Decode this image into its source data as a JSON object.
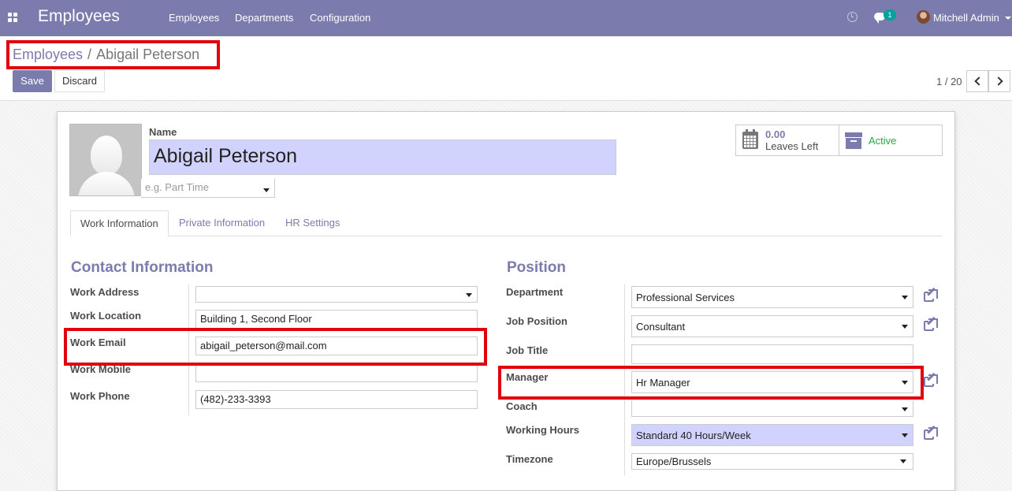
{
  "navbar": {
    "app_title": "Employees",
    "menu": [
      "Employees",
      "Departments",
      "Configuration"
    ],
    "notification_count": "1",
    "user_name": "Mitchell Admin",
    "bg_color": "#7c7bad"
  },
  "breadcrumb": {
    "parent": "Employees",
    "separator": "/",
    "current": "Abigail Peterson"
  },
  "toolbar": {
    "save_label": "Save",
    "discard_label": "Discard",
    "pager": "1 / 20"
  },
  "employee": {
    "name_label": "Name",
    "name": "Abigail Peterson",
    "category_placeholder": "e.g. Part Time"
  },
  "stats": {
    "leaves_value": "0.00",
    "leaves_label": "Leaves Left",
    "active_label": "Active"
  },
  "tabs": [
    "Work Information",
    "Private Information",
    "HR Settings"
  ],
  "contact": {
    "title": "Contact Information",
    "work_address_label": "Work Address",
    "work_address": "",
    "work_location_label": "Work Location",
    "work_location": "Building 1, Second Floor",
    "work_email_label": "Work Email",
    "work_email": "abigail_peterson@mail.com",
    "work_mobile_label": "Work Mobile",
    "work_mobile": "",
    "work_phone_label": "Work Phone",
    "work_phone": "(482)-233-3393"
  },
  "position": {
    "title": "Position",
    "department_label": "Department",
    "department": "Professional Services",
    "job_position_label": "Job Position",
    "job_position": "Consultant",
    "job_title_label": "Job Title",
    "job_title": "",
    "manager_label": "Manager",
    "manager": "Hr Manager",
    "coach_label": "Coach",
    "coach": "",
    "working_hours_label": "Working Hours",
    "working_hours": "Standard 40 Hours/Week",
    "timezone_label": "Timezone",
    "timezone": "Europe/Brussels"
  },
  "icons": {
    "apps": "apps-grid-icon",
    "clock": "clock-icon",
    "chat": "chat-icon",
    "calendar": "calendar-icon",
    "archive": "archive-icon",
    "external": "external-link-icon"
  },
  "annotation_color": "#e3000e"
}
